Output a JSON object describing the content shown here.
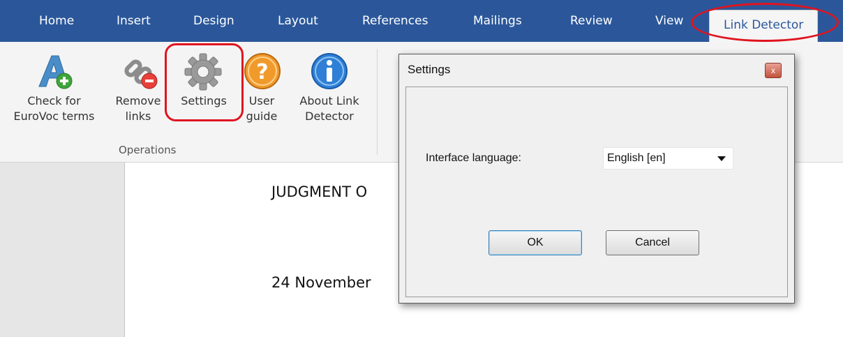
{
  "ribbon_tabs": [
    {
      "label": "Home"
    },
    {
      "label": "Insert"
    },
    {
      "label": "Design"
    },
    {
      "label": "Layout"
    },
    {
      "label": "References"
    },
    {
      "label": "Mailings"
    },
    {
      "label": "Review"
    },
    {
      "label": "View"
    },
    {
      "label": "Link Detector",
      "active": true
    }
  ],
  "ribbon": {
    "buttons": [
      {
        "label": "Check for\nEuroVoc terms",
        "icon": "eurovoc-add-icon"
      },
      {
        "label": "Remove\nlinks",
        "icon": "remove-links-icon"
      },
      {
        "label": "Settings",
        "icon": "gear-icon"
      },
      {
        "label": "User\nguide",
        "icon": "help-icon"
      },
      {
        "label": "About Link\nDetector",
        "icon": "info-icon"
      }
    ],
    "group_label": "Operations"
  },
  "document": {
    "line1": "JUDGMENT O",
    "line2": "24 November"
  },
  "dialog": {
    "title": "Settings",
    "close_glyph": "x",
    "field_label": "Interface language:",
    "language_value": "English [en]",
    "ok_label": "OK",
    "cancel_label": "Cancel"
  },
  "colors": {
    "tab_bar": "#2b579a",
    "highlight": "#e0141f",
    "help_icon": "#f09a2c",
    "info_icon": "#2f7fd6"
  }
}
